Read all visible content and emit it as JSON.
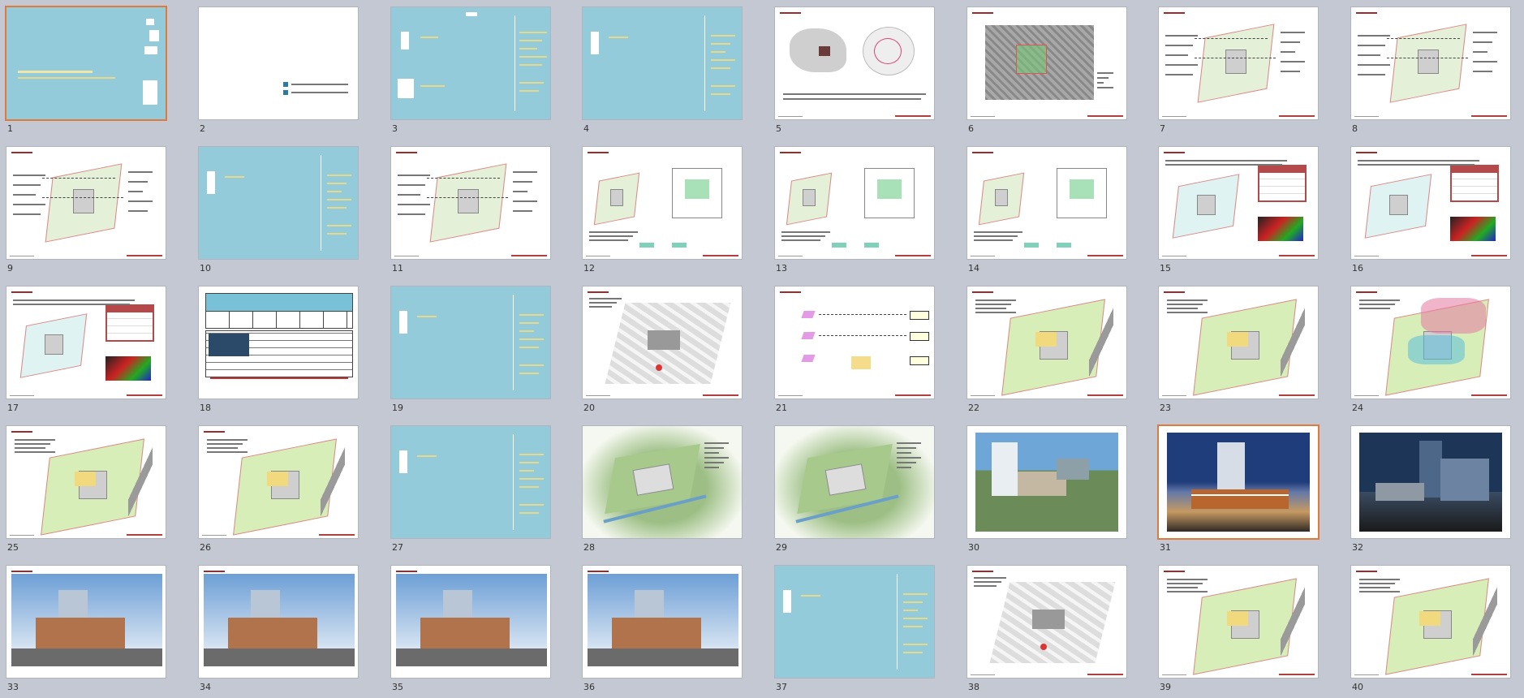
{
  "app": {
    "view": "slide-sorter"
  },
  "colors": {
    "background": "#c4c8d2",
    "section_slide": "#93cbda",
    "selection": "#e07a3c",
    "accent_red": "#9b2c2c"
  },
  "slides": [
    {
      "num": "1",
      "kind": "cover",
      "selected": true
    },
    {
      "num": "2",
      "kind": "white-logo",
      "selected": false
    },
    {
      "num": "3",
      "kind": "toc",
      "selected": false
    },
    {
      "num": "4",
      "kind": "section",
      "selected": false
    },
    {
      "num": "5",
      "kind": "maps",
      "selected": false
    },
    {
      "num": "6",
      "kind": "aerial",
      "selected": false
    },
    {
      "num": "7",
      "kind": "site-plan",
      "selected": false
    },
    {
      "num": "8",
      "kind": "site-plan",
      "selected": false
    },
    {
      "num": "9",
      "kind": "site-plan",
      "selected": false
    },
    {
      "num": "10",
      "kind": "section",
      "selected": false
    },
    {
      "num": "11",
      "kind": "site-plan",
      "selected": false
    },
    {
      "num": "12",
      "kind": "diagram",
      "selected": false
    },
    {
      "num": "13",
      "kind": "diagram",
      "selected": false
    },
    {
      "num": "14",
      "kind": "diagram",
      "selected": false
    },
    {
      "num": "15",
      "kind": "table-plan",
      "selected": false
    },
    {
      "num": "16",
      "kind": "table-plan",
      "selected": false
    },
    {
      "num": "17",
      "kind": "table-plan",
      "selected": false
    },
    {
      "num": "18",
      "kind": "table",
      "selected": false
    },
    {
      "num": "19",
      "kind": "section",
      "selected": false
    },
    {
      "num": "20",
      "kind": "plan-gray",
      "selected": false
    },
    {
      "num": "21",
      "kind": "flow",
      "selected": false
    },
    {
      "num": "22",
      "kind": "site-green",
      "selected": false
    },
    {
      "num": "23",
      "kind": "site-green",
      "selected": false
    },
    {
      "num": "24",
      "kind": "site-pink",
      "selected": false
    },
    {
      "num": "25",
      "kind": "site-green",
      "selected": false
    },
    {
      "num": "26",
      "kind": "site-green",
      "selected": false
    },
    {
      "num": "27",
      "kind": "section",
      "selected": false
    },
    {
      "num": "28",
      "kind": "render-plan",
      "selected": false
    },
    {
      "num": "29",
      "kind": "render-plan",
      "selected": false
    },
    {
      "num": "30",
      "kind": "photo-day",
      "selected": false
    },
    {
      "num": "31",
      "kind": "photo-dusk",
      "selected": true
    },
    {
      "num": "32",
      "kind": "photo-night",
      "selected": false
    },
    {
      "num": "33",
      "kind": "elevation",
      "selected": false
    },
    {
      "num": "34",
      "kind": "elevation",
      "selected": false
    },
    {
      "num": "35",
      "kind": "elevation",
      "selected": false
    },
    {
      "num": "36",
      "kind": "elevation",
      "selected": false
    },
    {
      "num": "37",
      "kind": "section",
      "selected": false
    },
    {
      "num": "38",
      "kind": "plan-gray",
      "selected": false
    },
    {
      "num": "39",
      "kind": "site-green",
      "selected": false
    },
    {
      "num": "40",
      "kind": "site-green",
      "selected": false
    }
  ]
}
